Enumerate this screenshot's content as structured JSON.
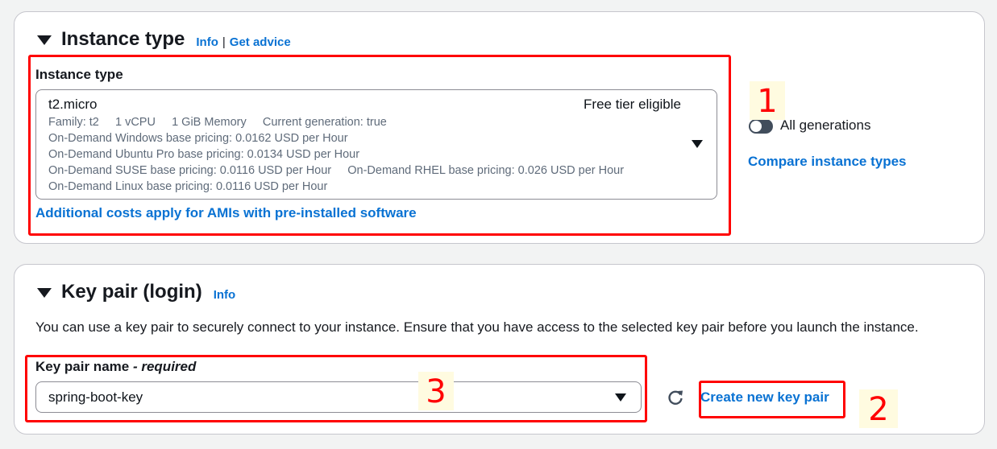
{
  "instance_type": {
    "title": "Instance type",
    "info_link": "Info",
    "separator": "|",
    "advice_link": "Get advice",
    "field_label": "Instance type",
    "selected": {
      "name": "t2.micro",
      "badge": "Free tier eligible",
      "details": [
        "Family: t2     1 vCPU     1 GiB Memory     Current generation: true",
        "On-Demand Windows base pricing: 0.0162 USD per Hour",
        "On-Demand Ubuntu Pro base pricing: 0.0134 USD per Hour",
        "On-Demand SUSE base pricing: 0.0116 USD per Hour     On-Demand RHEL base pricing: 0.026 USD per Hour",
        "On-Demand Linux base pricing: 0.0116 USD per Hour"
      ]
    },
    "additional_costs_link": "Additional costs apply for AMIs with pre-installed software",
    "toggle_label": "All generations",
    "compare_link": "Compare instance types"
  },
  "key_pair": {
    "title": "Key pair (login)",
    "info_link": "Info",
    "description": "You can use a key pair to securely connect to your instance. Ensure that you have access to the selected key pair before you launch the instance.",
    "field_label": "Key pair name",
    "required_label": "- required",
    "selected_value": "spring-boot-key",
    "create_link": "Create new key pair"
  },
  "annotations": {
    "one": "1",
    "two": "2",
    "three": "3"
  }
}
